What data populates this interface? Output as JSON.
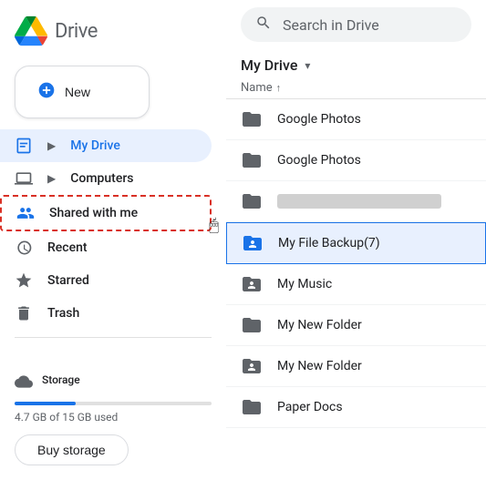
{
  "app": {
    "name": "Drive",
    "logo_alt": "Google Drive"
  },
  "search": {
    "placeholder": "Search in Drive"
  },
  "new_button": {
    "label": "New"
  },
  "sidebar": {
    "items": [
      {
        "id": "my-drive",
        "label": "My Drive",
        "icon": "my-drive-icon",
        "active": true,
        "has_chevron": true
      },
      {
        "id": "computers",
        "label": "Computers",
        "icon": "computers-icon",
        "active": false,
        "has_chevron": true
      },
      {
        "id": "shared-with-me",
        "label": "Shared with me",
        "icon": "shared-icon",
        "active": false,
        "has_chevron": false,
        "dashed_border": true
      },
      {
        "id": "recent",
        "label": "Recent",
        "icon": "recent-icon",
        "active": false,
        "has_chevron": false
      },
      {
        "id": "starred",
        "label": "Starred",
        "icon": "starred-icon",
        "active": false,
        "has_chevron": false
      },
      {
        "id": "trash",
        "label": "Trash",
        "icon": "trash-icon",
        "active": false,
        "has_chevron": false
      }
    ],
    "storage": {
      "label": "Storage",
      "used_text": "4.7 GB of 15 GB used",
      "used_percent": 31,
      "buy_button_label": "Buy storage"
    }
  },
  "main": {
    "title": "My Drive",
    "column_header": "Name",
    "sort_direction": "↑",
    "files": [
      {
        "id": "google-photos-1",
        "name": "Google Photos",
        "type": "folder",
        "shared": false,
        "selected": false,
        "redacted": false
      },
      {
        "id": "google-photos-2",
        "name": "Google Photos",
        "type": "folder",
        "shared": false,
        "selected": false,
        "redacted": false
      },
      {
        "id": "redacted-folder",
        "name": "",
        "type": "folder",
        "shared": false,
        "selected": false,
        "redacted": true
      },
      {
        "id": "my-file-backup",
        "name": "My File Backup(7)",
        "type": "shared-folder",
        "shared": true,
        "selected": true,
        "redacted": false
      },
      {
        "id": "my-music",
        "name": "My Music",
        "type": "shared-folder",
        "shared": true,
        "selected": false,
        "redacted": false
      },
      {
        "id": "my-new-folder-1",
        "name": "My New Folder",
        "type": "folder",
        "shared": false,
        "selected": false,
        "redacted": false
      },
      {
        "id": "my-new-folder-2",
        "name": "My New Folder",
        "type": "shared-folder",
        "shared": true,
        "selected": false,
        "redacted": false
      },
      {
        "id": "paper-docs",
        "name": "Paper Docs",
        "type": "folder",
        "shared": false,
        "selected": false,
        "redacted": false
      }
    ]
  }
}
